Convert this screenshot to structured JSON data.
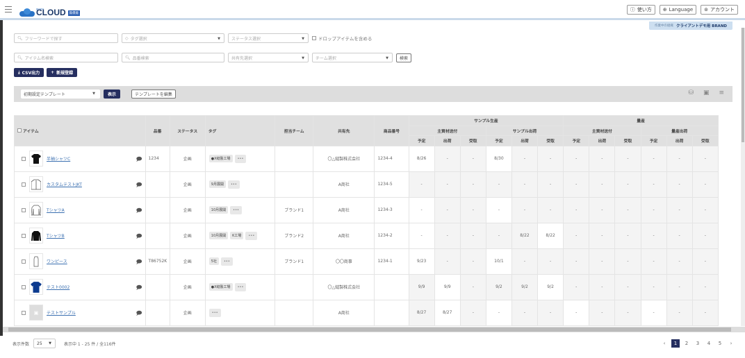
{
  "header": {
    "logo_small": "growu",
    "logo_text": "CLOUD",
    "logo_badge": "無償版",
    "buttons": [
      {
        "icon": "help-icon",
        "glyph": "⓪",
        "label": "使い方"
      },
      {
        "icon": "globe-icon",
        "glyph": "⊕",
        "label": "Language"
      },
      {
        "icon": "account-icon",
        "glyph": "☺",
        "label": "アカウント"
      }
    ],
    "brand_prefix": "作業中の組織",
    "brand_name": "クライアントデモ用 BRAND"
  },
  "filters": {
    "freeword_placeholder": "フリーワードで探す",
    "tag_placeholder": "タグ選択",
    "status_placeholder": "ステータス選択",
    "drop_items_label": "ドロップアイテムを含める",
    "item_name_placeholder": "アイテム名検索",
    "part_no_placeholder": "品番検索",
    "share_placeholder": "共有先選択",
    "team_placeholder": "チーム選択",
    "search_label": "検索"
  },
  "actions": {
    "csv_label": "CSV出力",
    "new_label": "新規登録"
  },
  "template": {
    "selected": "初期設定テンプレート",
    "show_label": "表示",
    "edit_label": "テンプレートを編集"
  },
  "table": {
    "headers": {
      "item": "アイテム",
      "part_no": "品番",
      "status": "ステータス",
      "tag": "タグ",
      "team": "担当チーム",
      "share": "共有先",
      "product_no": "商品番号",
      "sample_production": "サンプル生産",
      "mass_production": "量産",
      "main_material_shipping": "主資材送付",
      "sample_shipping": "サンプル出荷",
      "mass_shipping": "量産出荷",
      "plan": "予定",
      "shipped": "出荷",
      "received": "受取"
    },
    "rows": [
      {
        "name": "半袖シャツC",
        "thumb": "black-tshirt",
        "part_no": "1234",
        "status": "企画",
        "tags": [
          "●X縫製工場"
        ],
        "team": "",
        "share": "〇△縫製株式会社",
        "product_no": "1234-4",
        "dates": [
          "8/26",
          "-",
          "-",
          "8/30",
          "-",
          "-",
          "-",
          "-",
          "-",
          "-",
          "-",
          "-"
        ],
        "white": [
          0,
          3
        ]
      },
      {
        "name": "カスタムテストJKT",
        "thumb": "jacket",
        "part_no": "",
        "status": "企画",
        "tags": [
          "9月展開"
        ],
        "team": "",
        "share": "A商社",
        "product_no": "1234-5",
        "dates": [
          "-",
          "-",
          "-",
          "-",
          "-",
          "-",
          "-",
          "-",
          "-",
          "-",
          "-",
          "-"
        ],
        "white": []
      },
      {
        "name": "TシャツA",
        "thumb": "longsleeve-outline",
        "part_no": "",
        "status": "企画",
        "tags": [
          "10月展開"
        ],
        "team": "ブランド1",
        "share": "A商社",
        "product_no": "1234-3",
        "dates": [
          "-",
          "-",
          "-",
          "-",
          "-",
          "-",
          "-",
          "-",
          "-",
          "-",
          "-",
          "-"
        ],
        "white": [
          0,
          3
        ]
      },
      {
        "name": "TシャツB",
        "thumb": "longsleeve-black",
        "part_no": "",
        "status": "企画",
        "tags": [
          "10月展開",
          "K工場"
        ],
        "team": "ブランド2",
        "share": "A商社",
        "product_no": "1234-2",
        "dates": [
          "-",
          "-",
          "-",
          "-",
          "8/22",
          "8/22",
          "-",
          "-",
          "-",
          "-",
          "-",
          "-"
        ],
        "white": [
          0,
          5
        ]
      },
      {
        "name": "ワンピース",
        "thumb": "dress",
        "part_no": "T86752K",
        "status": "企画",
        "tags": [
          "5社"
        ],
        "team": "ブランド1",
        "share": "〇〇商事",
        "product_no": "1234-1",
        "dates": [
          "9/23",
          "-",
          "-",
          "10/1",
          "-",
          "-",
          "-",
          "-",
          "-",
          "-",
          "-",
          "-"
        ],
        "white": [
          0,
          3
        ]
      },
      {
        "name": "テスト0002",
        "thumb": "blue-tshirt",
        "part_no": "",
        "status": "企画",
        "tags": [
          "●X縫製工場"
        ],
        "team": "",
        "share": "〇△縫製株式会社",
        "product_no": "",
        "dates": [
          "9/9",
          "9/9",
          "-",
          "9/2",
          "9/2",
          "9/2",
          "-",
          "-",
          "-",
          "-",
          "-",
          "-"
        ],
        "white": [
          1,
          5
        ]
      },
      {
        "name": "テストサンプル",
        "thumb": "placeholder",
        "part_no": "",
        "status": "企画",
        "tags": [],
        "team": "",
        "share": "A商社",
        "product_no": "",
        "dates": [
          "8/27",
          "8/27",
          "-",
          "-",
          "-",
          "-",
          "-",
          "-",
          "-",
          "-",
          "-",
          "-"
        ],
        "white": [
          1,
          3,
          6,
          9
        ]
      }
    ]
  },
  "footer": {
    "per_page_label": "表示件数",
    "per_page_value": "25",
    "range_text": "表示中 1 - 25 件 / 全116件",
    "pages": [
      "1",
      "2",
      "3",
      "4",
      "5"
    ],
    "current_page": "1"
  },
  "colors": {
    "primary_dark": "#252e5f",
    "link": "#3a6fb0",
    "header_bg": "#e0e0e0"
  }
}
